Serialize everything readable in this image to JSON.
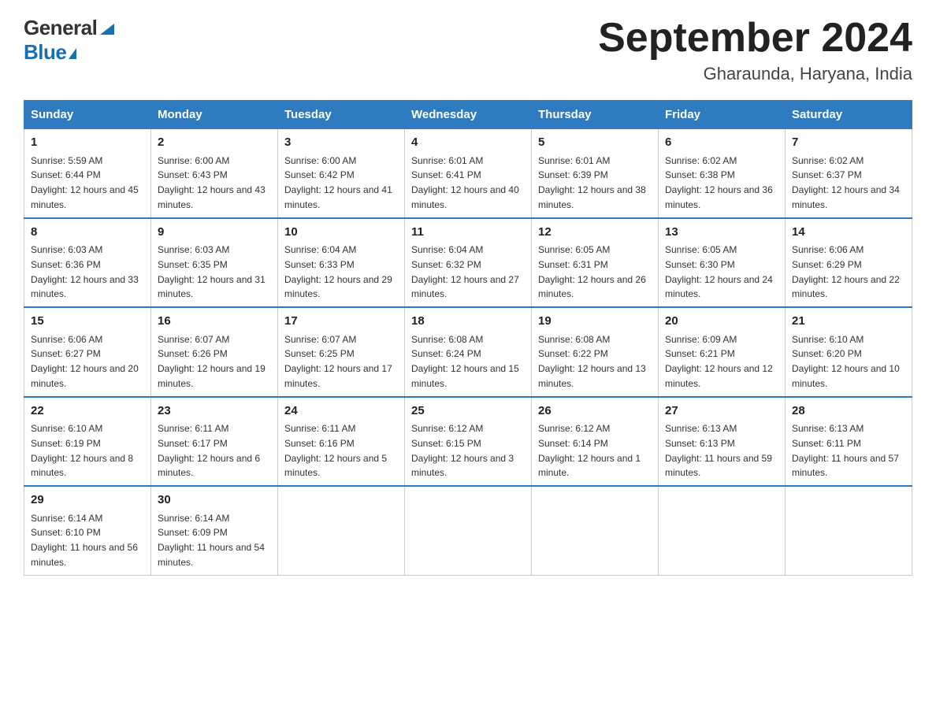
{
  "logo": {
    "general": "General",
    "blue": "Blue"
  },
  "title": "September 2024",
  "location": "Gharaunda, Haryana, India",
  "days_header": [
    "Sunday",
    "Monday",
    "Tuesday",
    "Wednesday",
    "Thursday",
    "Friday",
    "Saturday"
  ],
  "weeks": [
    [
      {
        "day": "1",
        "sunrise": "Sunrise: 5:59 AM",
        "sunset": "Sunset: 6:44 PM",
        "daylight": "Daylight: 12 hours and 45 minutes."
      },
      {
        "day": "2",
        "sunrise": "Sunrise: 6:00 AM",
        "sunset": "Sunset: 6:43 PM",
        "daylight": "Daylight: 12 hours and 43 minutes."
      },
      {
        "day": "3",
        "sunrise": "Sunrise: 6:00 AM",
        "sunset": "Sunset: 6:42 PM",
        "daylight": "Daylight: 12 hours and 41 minutes."
      },
      {
        "day": "4",
        "sunrise": "Sunrise: 6:01 AM",
        "sunset": "Sunset: 6:41 PM",
        "daylight": "Daylight: 12 hours and 40 minutes."
      },
      {
        "day": "5",
        "sunrise": "Sunrise: 6:01 AM",
        "sunset": "Sunset: 6:39 PM",
        "daylight": "Daylight: 12 hours and 38 minutes."
      },
      {
        "day": "6",
        "sunrise": "Sunrise: 6:02 AM",
        "sunset": "Sunset: 6:38 PM",
        "daylight": "Daylight: 12 hours and 36 minutes."
      },
      {
        "day": "7",
        "sunrise": "Sunrise: 6:02 AM",
        "sunset": "Sunset: 6:37 PM",
        "daylight": "Daylight: 12 hours and 34 minutes."
      }
    ],
    [
      {
        "day": "8",
        "sunrise": "Sunrise: 6:03 AM",
        "sunset": "Sunset: 6:36 PM",
        "daylight": "Daylight: 12 hours and 33 minutes."
      },
      {
        "day": "9",
        "sunrise": "Sunrise: 6:03 AM",
        "sunset": "Sunset: 6:35 PM",
        "daylight": "Daylight: 12 hours and 31 minutes."
      },
      {
        "day": "10",
        "sunrise": "Sunrise: 6:04 AM",
        "sunset": "Sunset: 6:33 PM",
        "daylight": "Daylight: 12 hours and 29 minutes."
      },
      {
        "day": "11",
        "sunrise": "Sunrise: 6:04 AM",
        "sunset": "Sunset: 6:32 PM",
        "daylight": "Daylight: 12 hours and 27 minutes."
      },
      {
        "day": "12",
        "sunrise": "Sunrise: 6:05 AM",
        "sunset": "Sunset: 6:31 PM",
        "daylight": "Daylight: 12 hours and 26 minutes."
      },
      {
        "day": "13",
        "sunrise": "Sunrise: 6:05 AM",
        "sunset": "Sunset: 6:30 PM",
        "daylight": "Daylight: 12 hours and 24 minutes."
      },
      {
        "day": "14",
        "sunrise": "Sunrise: 6:06 AM",
        "sunset": "Sunset: 6:29 PM",
        "daylight": "Daylight: 12 hours and 22 minutes."
      }
    ],
    [
      {
        "day": "15",
        "sunrise": "Sunrise: 6:06 AM",
        "sunset": "Sunset: 6:27 PM",
        "daylight": "Daylight: 12 hours and 20 minutes."
      },
      {
        "day": "16",
        "sunrise": "Sunrise: 6:07 AM",
        "sunset": "Sunset: 6:26 PM",
        "daylight": "Daylight: 12 hours and 19 minutes."
      },
      {
        "day": "17",
        "sunrise": "Sunrise: 6:07 AM",
        "sunset": "Sunset: 6:25 PM",
        "daylight": "Daylight: 12 hours and 17 minutes."
      },
      {
        "day": "18",
        "sunrise": "Sunrise: 6:08 AM",
        "sunset": "Sunset: 6:24 PM",
        "daylight": "Daylight: 12 hours and 15 minutes."
      },
      {
        "day": "19",
        "sunrise": "Sunrise: 6:08 AM",
        "sunset": "Sunset: 6:22 PM",
        "daylight": "Daylight: 12 hours and 13 minutes."
      },
      {
        "day": "20",
        "sunrise": "Sunrise: 6:09 AM",
        "sunset": "Sunset: 6:21 PM",
        "daylight": "Daylight: 12 hours and 12 minutes."
      },
      {
        "day": "21",
        "sunrise": "Sunrise: 6:10 AM",
        "sunset": "Sunset: 6:20 PM",
        "daylight": "Daylight: 12 hours and 10 minutes."
      }
    ],
    [
      {
        "day": "22",
        "sunrise": "Sunrise: 6:10 AM",
        "sunset": "Sunset: 6:19 PM",
        "daylight": "Daylight: 12 hours and 8 minutes."
      },
      {
        "day": "23",
        "sunrise": "Sunrise: 6:11 AM",
        "sunset": "Sunset: 6:17 PM",
        "daylight": "Daylight: 12 hours and 6 minutes."
      },
      {
        "day": "24",
        "sunrise": "Sunrise: 6:11 AM",
        "sunset": "Sunset: 6:16 PM",
        "daylight": "Daylight: 12 hours and 5 minutes."
      },
      {
        "day": "25",
        "sunrise": "Sunrise: 6:12 AM",
        "sunset": "Sunset: 6:15 PM",
        "daylight": "Daylight: 12 hours and 3 minutes."
      },
      {
        "day": "26",
        "sunrise": "Sunrise: 6:12 AM",
        "sunset": "Sunset: 6:14 PM",
        "daylight": "Daylight: 12 hours and 1 minute."
      },
      {
        "day": "27",
        "sunrise": "Sunrise: 6:13 AM",
        "sunset": "Sunset: 6:13 PM",
        "daylight": "Daylight: 11 hours and 59 minutes."
      },
      {
        "day": "28",
        "sunrise": "Sunrise: 6:13 AM",
        "sunset": "Sunset: 6:11 PM",
        "daylight": "Daylight: 11 hours and 57 minutes."
      }
    ],
    [
      {
        "day": "29",
        "sunrise": "Sunrise: 6:14 AM",
        "sunset": "Sunset: 6:10 PM",
        "daylight": "Daylight: 11 hours and 56 minutes."
      },
      {
        "day": "30",
        "sunrise": "Sunrise: 6:14 AM",
        "sunset": "Sunset: 6:09 PM",
        "daylight": "Daylight: 11 hours and 54 minutes."
      },
      null,
      null,
      null,
      null,
      null
    ]
  ]
}
